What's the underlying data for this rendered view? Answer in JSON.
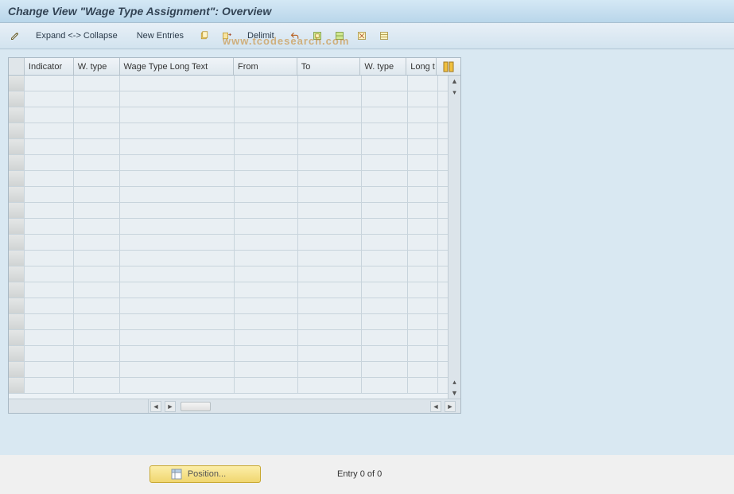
{
  "header": {
    "title": "Change View \"Wage Type Assignment\": Overview"
  },
  "toolbar": {
    "expand_label": "Expand <-> Collapse",
    "new_entries_label": "New Entries",
    "delimit_label": "Delimit"
  },
  "table": {
    "columns": {
      "indicator": "Indicator",
      "wtype": "W. type",
      "longtext": "Wage Type Long Text",
      "from": "From",
      "to": "To",
      "wtype2": "W. type",
      "long2": "Long t"
    },
    "rows": []
  },
  "footer": {
    "position_label": "Position...",
    "entry_status": "Entry 0 of 0"
  },
  "watermark": "www.tcodesearch.com"
}
